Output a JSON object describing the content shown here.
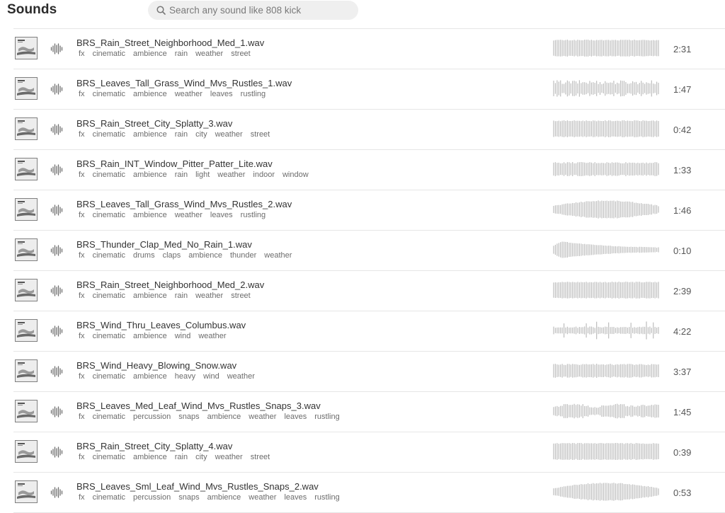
{
  "header": {
    "title": "Sounds"
  },
  "search": {
    "placeholder": "Search any sound like 808 kick",
    "value": ""
  },
  "colors": {
    "waveform": "#bdbdbd",
    "icon": "#6f6f6f",
    "divider": "#e6e6e6"
  },
  "sounds": [
    {
      "name": "BRS_Rain_Street_Neighborhood_Med_1.wav",
      "tags": [
        "fx",
        "cinematic",
        "ambience",
        "rain",
        "weather",
        "street"
      ],
      "duration": "2:31",
      "wave": "uniform"
    },
    {
      "name": "BRS_Leaves_Tall_Grass_Wind_Mvs_Rustles_1.wav",
      "tags": [
        "fx",
        "cinematic",
        "ambience",
        "weather",
        "leaves",
        "rustling"
      ],
      "duration": "1:47",
      "wave": "varied"
    },
    {
      "name": "BRS_Rain_Street_City_Splatty_3.wav",
      "tags": [
        "fx",
        "cinematic",
        "ambience",
        "rain",
        "city",
        "weather",
        "street"
      ],
      "duration": "0:42",
      "wave": "uniform"
    },
    {
      "name": "BRS_Rain_INT_Window_Pitter_Patter_Lite.wav",
      "tags": [
        "fx",
        "cinematic",
        "ambience",
        "rain",
        "light",
        "weather",
        "indoor",
        "window"
      ],
      "duration": "1:33",
      "wave": "uniform-soft"
    },
    {
      "name": "BRS_Leaves_Tall_Grass_Wind_Mvs_Rustles_2.wav",
      "tags": [
        "fx",
        "cinematic",
        "ambience",
        "weather",
        "leaves",
        "rustling"
      ],
      "duration": "1:46",
      "wave": "swell"
    },
    {
      "name": "BRS_Thunder_Clap_Med_No_Rain_1.wav",
      "tags": [
        "fx",
        "cinematic",
        "drums",
        "claps",
        "ambience",
        "thunder",
        "weather"
      ],
      "duration": "0:10",
      "wave": "decay"
    },
    {
      "name": "BRS_Rain_Street_Neighborhood_Med_2.wav",
      "tags": [
        "fx",
        "cinematic",
        "ambience",
        "rain",
        "weather",
        "street"
      ],
      "duration": "2:39",
      "wave": "uniform"
    },
    {
      "name": "BRS_Wind_Thru_Leaves_Columbus.wav",
      "tags": [
        "fx",
        "cinematic",
        "ambience",
        "wind",
        "weather"
      ],
      "duration": "4:22",
      "wave": "sparse"
    },
    {
      "name": "BRS_Wind_Heavy_Blowing_Snow.wav",
      "tags": [
        "fx",
        "cinematic",
        "ambience",
        "heavy",
        "wind",
        "weather"
      ],
      "duration": "3:37",
      "wave": "uniform-soft"
    },
    {
      "name": "BRS_Leaves_Med_Leaf_Wind_Mvs_Rustles_Snaps_3.wav",
      "tags": [
        "fx",
        "cinematic",
        "percussion",
        "snaps",
        "ambience",
        "weather",
        "leaves",
        "rustling"
      ],
      "duration": "1:45",
      "wave": "bumpy"
    },
    {
      "name": "BRS_Rain_Street_City_Splatty_4.wav",
      "tags": [
        "fx",
        "cinematic",
        "ambience",
        "rain",
        "city",
        "weather",
        "street"
      ],
      "duration": "0:39",
      "wave": "uniform"
    },
    {
      "name": "BRS_Leaves_Sml_Leaf_Wind_Mvs_Rustles_Snaps_2.wav",
      "tags": [
        "fx",
        "cinematic",
        "percussion",
        "snaps",
        "ambience",
        "weather",
        "leaves",
        "rustling"
      ],
      "duration": "0:53",
      "wave": "swell"
    }
  ]
}
